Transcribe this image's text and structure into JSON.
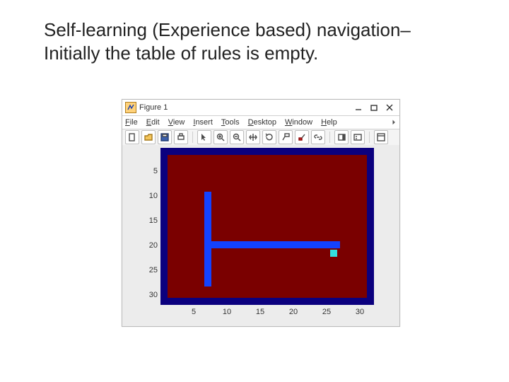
{
  "heading_line1": "Self-learning (Experience based) navigation–",
  "heading_line2": "Initially the table of rules is empty.",
  "window": {
    "title": "Figure 1"
  },
  "menu": {
    "file": "File",
    "edit": "Edit",
    "view": "View",
    "insert": "Insert",
    "tools": "Tools",
    "desktop": "Desktop",
    "window": "Window",
    "help": "Help"
  },
  "ticks": {
    "y": [
      "5",
      "10",
      "15",
      "20",
      "25",
      "30"
    ],
    "x": [
      "5",
      "10",
      "15",
      "20",
      "25",
      "30"
    ]
  },
  "chart_data": {
    "type": "heatmap",
    "title": "",
    "xlabel": "",
    "ylabel": "",
    "xlim": [
      0,
      32
    ],
    "ylim": [
      0,
      32
    ],
    "xticks": [
      5,
      10,
      15,
      20,
      25,
      30
    ],
    "yticks": [
      5,
      10,
      15,
      20,
      25,
      30
    ],
    "background_value": 0,
    "border_value": 2,
    "walls": [
      {
        "orientation": "vertical",
        "x": 7,
        "y_start": 10,
        "y_end": 28
      },
      {
        "orientation": "horizontal",
        "y": 20,
        "x_start": 7,
        "x_end": 28
      }
    ],
    "agent": {
      "x": 26,
      "y": 21
    },
    "color_map": {
      "0": "#7a0000",
      "1": "#1342ff",
      "2": "#0b007e",
      "agent": "#34e0e0"
    }
  }
}
